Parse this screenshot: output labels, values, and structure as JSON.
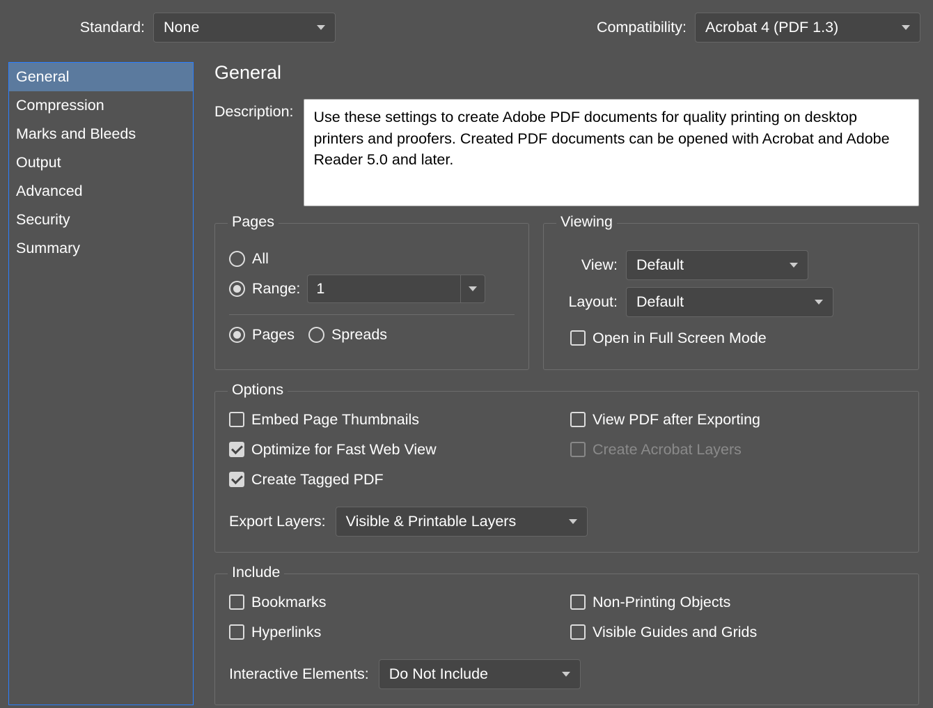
{
  "top": {
    "standard_label": "Standard:",
    "standard_value": "None",
    "compatibility_label": "Compatibility:",
    "compatibility_value": "Acrobat 4 (PDF 1.3)"
  },
  "sidebar": {
    "items": [
      "General",
      "Compression",
      "Marks and Bleeds",
      "Output",
      "Advanced",
      "Security",
      "Summary"
    ],
    "selected_index": 0
  },
  "general": {
    "title": "General",
    "description_label": "Description:",
    "description_text": "Use these settings to create Adobe PDF documents for quality printing on desktop printers and proofers.  Created PDF documents can be opened with Acrobat and Adobe Reader 5.0 and later."
  },
  "pages": {
    "legend": "Pages",
    "all_label": "All",
    "range_label": "Range:",
    "range_value": "1",
    "pages_label": "Pages",
    "spreads_label": "Spreads",
    "range_selected": true,
    "pages_selected": true
  },
  "viewing": {
    "legend": "Viewing",
    "view_label": "View:",
    "view_value": "Default",
    "layout_label": "Layout:",
    "layout_value": "Default",
    "fullscreen_label": "Open in Full Screen Mode",
    "fullscreen_checked": false
  },
  "options": {
    "legend": "Options",
    "embed_thumbnails": "Embed Page Thumbnails",
    "optimize_fast_web": "Optimize for Fast Web View",
    "create_tagged": "Create Tagged PDF",
    "view_after_export": "View PDF after Exporting",
    "create_layers": "Create Acrobat Layers",
    "export_layers_label": "Export Layers:",
    "export_layers_value": "Visible & Printable Layers"
  },
  "include": {
    "legend": "Include",
    "bookmarks": "Bookmarks",
    "hyperlinks": "Hyperlinks",
    "nonprinting": "Non-Printing Objects",
    "visible_guides": "Visible Guides and Grids",
    "interactive_label": "Interactive Elements:",
    "interactive_value": "Do Not Include"
  }
}
